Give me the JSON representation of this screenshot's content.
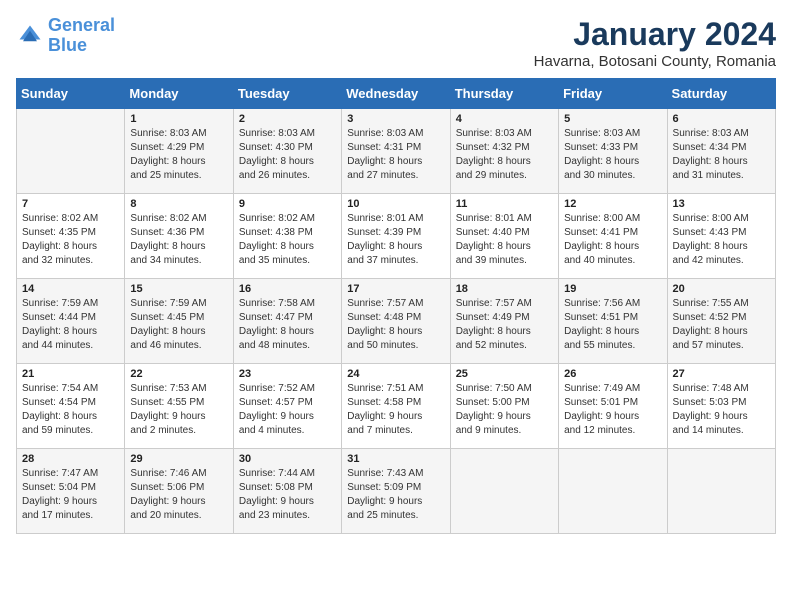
{
  "header": {
    "logo_line1": "General",
    "logo_line2": "Blue",
    "title": "January 2024",
    "subtitle": "Havarna, Botosani County, Romania"
  },
  "days_of_week": [
    "Sunday",
    "Monday",
    "Tuesday",
    "Wednesday",
    "Thursday",
    "Friday",
    "Saturday"
  ],
  "weeks": [
    [
      {
        "day": "",
        "info": ""
      },
      {
        "day": "1",
        "info": "Sunrise: 8:03 AM\nSunset: 4:29 PM\nDaylight: 8 hours\nand 25 minutes."
      },
      {
        "day": "2",
        "info": "Sunrise: 8:03 AM\nSunset: 4:30 PM\nDaylight: 8 hours\nand 26 minutes."
      },
      {
        "day": "3",
        "info": "Sunrise: 8:03 AM\nSunset: 4:31 PM\nDaylight: 8 hours\nand 27 minutes."
      },
      {
        "day": "4",
        "info": "Sunrise: 8:03 AM\nSunset: 4:32 PM\nDaylight: 8 hours\nand 29 minutes."
      },
      {
        "day": "5",
        "info": "Sunrise: 8:03 AM\nSunset: 4:33 PM\nDaylight: 8 hours\nand 30 minutes."
      },
      {
        "day": "6",
        "info": "Sunrise: 8:03 AM\nSunset: 4:34 PM\nDaylight: 8 hours\nand 31 minutes."
      }
    ],
    [
      {
        "day": "7",
        "info": "Sunrise: 8:02 AM\nSunset: 4:35 PM\nDaylight: 8 hours\nand 32 minutes."
      },
      {
        "day": "8",
        "info": "Sunrise: 8:02 AM\nSunset: 4:36 PM\nDaylight: 8 hours\nand 34 minutes."
      },
      {
        "day": "9",
        "info": "Sunrise: 8:02 AM\nSunset: 4:38 PM\nDaylight: 8 hours\nand 35 minutes."
      },
      {
        "day": "10",
        "info": "Sunrise: 8:01 AM\nSunset: 4:39 PM\nDaylight: 8 hours\nand 37 minutes."
      },
      {
        "day": "11",
        "info": "Sunrise: 8:01 AM\nSunset: 4:40 PM\nDaylight: 8 hours\nand 39 minutes."
      },
      {
        "day": "12",
        "info": "Sunrise: 8:00 AM\nSunset: 4:41 PM\nDaylight: 8 hours\nand 40 minutes."
      },
      {
        "day": "13",
        "info": "Sunrise: 8:00 AM\nSunset: 4:43 PM\nDaylight: 8 hours\nand 42 minutes."
      }
    ],
    [
      {
        "day": "14",
        "info": "Sunrise: 7:59 AM\nSunset: 4:44 PM\nDaylight: 8 hours\nand 44 minutes."
      },
      {
        "day": "15",
        "info": "Sunrise: 7:59 AM\nSunset: 4:45 PM\nDaylight: 8 hours\nand 46 minutes."
      },
      {
        "day": "16",
        "info": "Sunrise: 7:58 AM\nSunset: 4:47 PM\nDaylight: 8 hours\nand 48 minutes."
      },
      {
        "day": "17",
        "info": "Sunrise: 7:57 AM\nSunset: 4:48 PM\nDaylight: 8 hours\nand 50 minutes."
      },
      {
        "day": "18",
        "info": "Sunrise: 7:57 AM\nSunset: 4:49 PM\nDaylight: 8 hours\nand 52 minutes."
      },
      {
        "day": "19",
        "info": "Sunrise: 7:56 AM\nSunset: 4:51 PM\nDaylight: 8 hours\nand 55 minutes."
      },
      {
        "day": "20",
        "info": "Sunrise: 7:55 AM\nSunset: 4:52 PM\nDaylight: 8 hours\nand 57 minutes."
      }
    ],
    [
      {
        "day": "21",
        "info": "Sunrise: 7:54 AM\nSunset: 4:54 PM\nDaylight: 8 hours\nand 59 minutes."
      },
      {
        "day": "22",
        "info": "Sunrise: 7:53 AM\nSunset: 4:55 PM\nDaylight: 9 hours\nand 2 minutes."
      },
      {
        "day": "23",
        "info": "Sunrise: 7:52 AM\nSunset: 4:57 PM\nDaylight: 9 hours\nand 4 minutes."
      },
      {
        "day": "24",
        "info": "Sunrise: 7:51 AM\nSunset: 4:58 PM\nDaylight: 9 hours\nand 7 minutes."
      },
      {
        "day": "25",
        "info": "Sunrise: 7:50 AM\nSunset: 5:00 PM\nDaylight: 9 hours\nand 9 minutes."
      },
      {
        "day": "26",
        "info": "Sunrise: 7:49 AM\nSunset: 5:01 PM\nDaylight: 9 hours\nand 12 minutes."
      },
      {
        "day": "27",
        "info": "Sunrise: 7:48 AM\nSunset: 5:03 PM\nDaylight: 9 hours\nand 14 minutes."
      }
    ],
    [
      {
        "day": "28",
        "info": "Sunrise: 7:47 AM\nSunset: 5:04 PM\nDaylight: 9 hours\nand 17 minutes."
      },
      {
        "day": "29",
        "info": "Sunrise: 7:46 AM\nSunset: 5:06 PM\nDaylight: 9 hours\nand 20 minutes."
      },
      {
        "day": "30",
        "info": "Sunrise: 7:44 AM\nSunset: 5:08 PM\nDaylight: 9 hours\nand 23 minutes."
      },
      {
        "day": "31",
        "info": "Sunrise: 7:43 AM\nSunset: 5:09 PM\nDaylight: 9 hours\nand 25 minutes."
      },
      {
        "day": "",
        "info": ""
      },
      {
        "day": "",
        "info": ""
      },
      {
        "day": "",
        "info": ""
      }
    ]
  ]
}
